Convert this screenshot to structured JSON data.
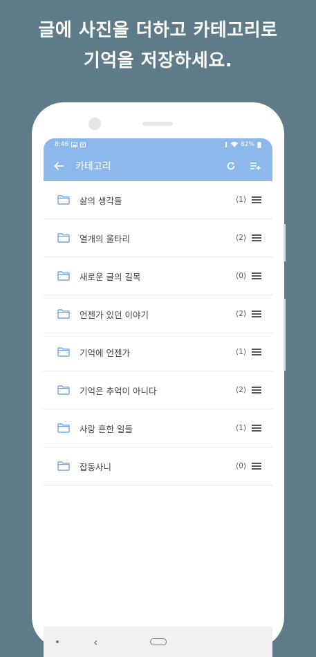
{
  "headline": {
    "line1": "글에 사진을 더하고 카테고리로",
    "line2": "기억을 저장하세요."
  },
  "status_bar": {
    "time": "8:46",
    "left_icons": [
      "image-icon",
      "notification-icon"
    ],
    "battery": "82%",
    "right_icons": [
      "mute-icon",
      "wifi-icon",
      "battery-icon"
    ]
  },
  "app_bar": {
    "title": "카테고리",
    "back_icon": "arrow-left-icon",
    "actions": [
      "refresh-icon",
      "playlist-add-icon"
    ]
  },
  "categories": [
    {
      "label": "삶의 생각들",
      "count": "(1)"
    },
    {
      "label": "열개의 울타리",
      "count": "(2)"
    },
    {
      "label": "새로운 글의 길목",
      "count": "(0)"
    },
    {
      "label": "언젠가 있던 이야기",
      "count": "(2)"
    },
    {
      "label": "기억에 언젠가",
      "count": "(1)"
    },
    {
      "label": "기억은 추억이 아니다",
      "count": "(2)"
    },
    {
      "label": "사랑 흔한 일들",
      "count": "(1)"
    },
    {
      "label": "잡동사니",
      "count": "(0)"
    }
  ],
  "colors": {
    "background": "#5f7b89",
    "accent": "#8cb8ec",
    "folder_icon": "#6fa3e0"
  }
}
